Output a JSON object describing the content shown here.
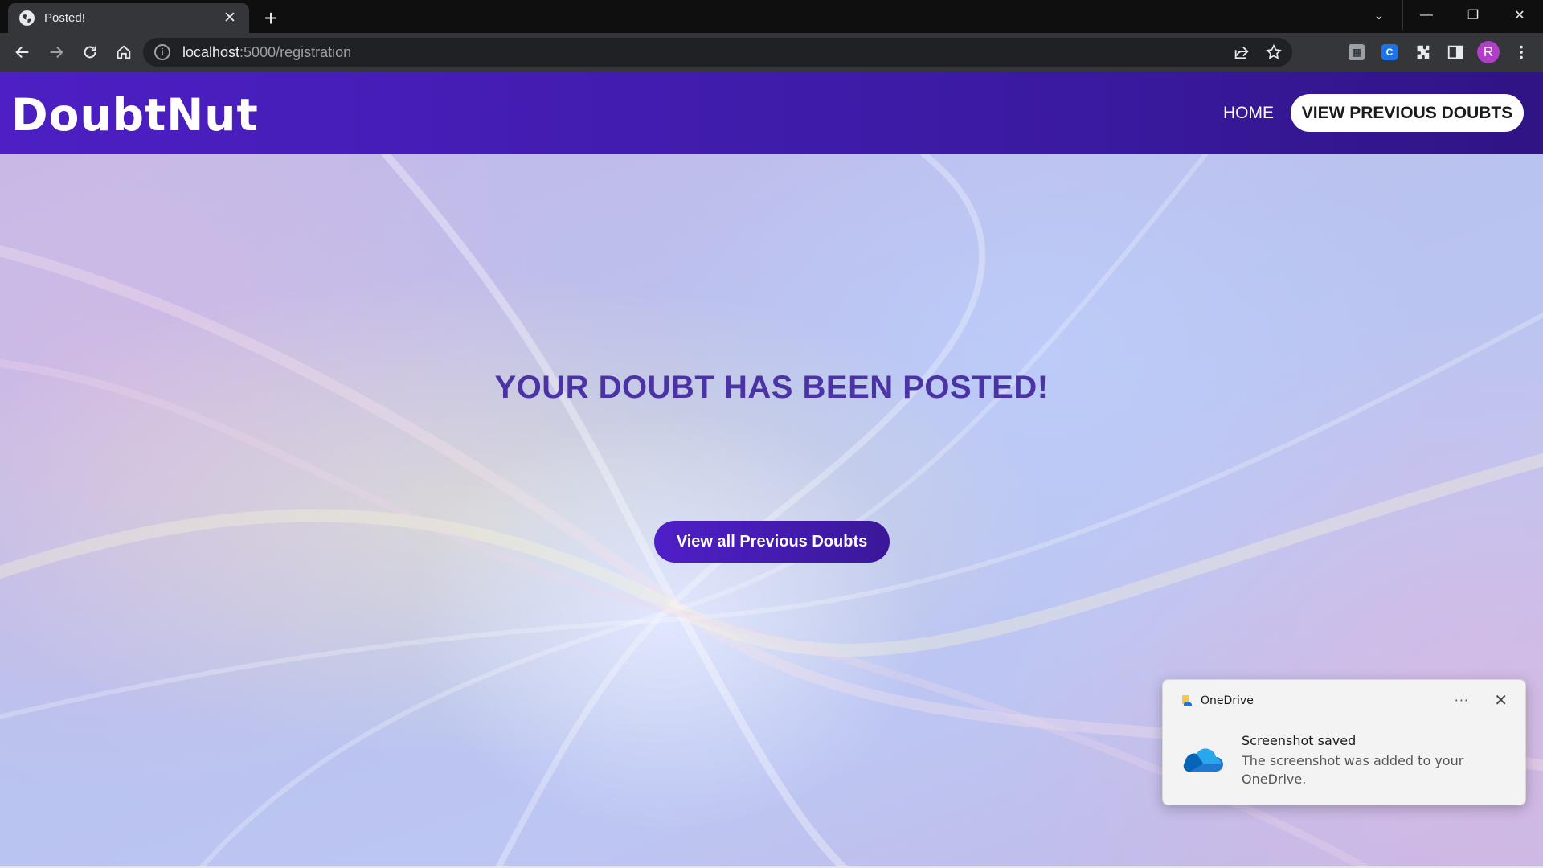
{
  "browser": {
    "tab_title": "Posted!",
    "tab_close": "✕",
    "new_tab": "+",
    "url_host": "localhost",
    "url_rest": ":5000/registration",
    "profile_initial": "R"
  },
  "navbar": {
    "brand": "DoubtNut",
    "home_label": "HOME",
    "view_previous_label": "VIEW PREVIOUS DOUBTS"
  },
  "main": {
    "heading": "YOUR DOUBT HAS BEEN POSTED!",
    "view_all_button": "View all Previous Doubts"
  },
  "toast": {
    "app_name": "OneDrive",
    "more": "···",
    "close": "✕",
    "title": "Screenshot saved",
    "body": "The screenshot was added to your OneDrive."
  },
  "colors": {
    "navbar": "#4d1fc4",
    "heading": "#4b33a6",
    "button": "#4f1fc9"
  }
}
